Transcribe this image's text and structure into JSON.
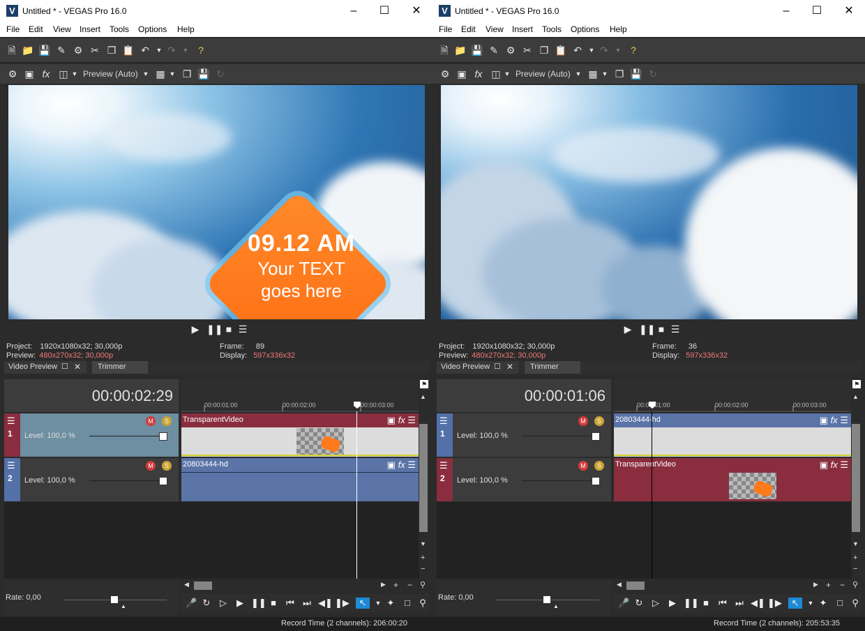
{
  "windows": [
    {
      "title": "Untitled * - VEGAS Pro 16.0",
      "menu": [
        "File",
        "Edit",
        "View",
        "Insert",
        "Tools",
        "Options",
        "Help"
      ],
      "preview_mode": "Preview (Auto)",
      "overlay": {
        "time": "09.12 AM",
        "line1": "Your TEXT",
        "line2": "goes here"
      },
      "info": {
        "project_label": "Project:",
        "project_value": "1920x1080x32; 30,000p",
        "preview_label": "Preview:",
        "preview_value": "480x270x32; 30,000p",
        "frame_label": "Frame:",
        "frame_value": "89",
        "display_label": "Display:",
        "display_value": "597x336x32"
      },
      "tabs": {
        "active": "Video Preview",
        "second": "Trimmer"
      },
      "timecode": "00:00:02:29",
      "ruler": [
        "00:00:01:00",
        "00:00:02:00",
        "00:00:03:00"
      ],
      "tracks": [
        {
          "number": "1",
          "level": "Level: 100,0 %",
          "event": "TransparentVideo"
        },
        {
          "number": "2",
          "level": "Level: 100,0 %",
          "event": "20803444-hd"
        }
      ],
      "rate": "Rate: 0,00",
      "status": "Record Time (2 channels): 206:00:20"
    },
    {
      "title": "Untitled * - VEGAS Pro 16.0",
      "menu": [
        "File",
        "Edit",
        "View",
        "Insert",
        "Tools",
        "Options",
        "Help"
      ],
      "preview_mode": "Preview (Auto)",
      "info": {
        "project_label": "Project:",
        "project_value": "1920x1080x32; 30,000p",
        "preview_label": "Preview:",
        "preview_value": "480x270x32; 30,000p",
        "frame_label": "Frame:",
        "frame_value": "36",
        "display_label": "Display:",
        "display_value": "597x336x32"
      },
      "tabs": {
        "active": "Video Preview",
        "second": "Trimmer"
      },
      "timecode": "00:00:01:06",
      "ruler": [
        "00:00:01:00",
        "00:00:02:00",
        "00:00:03:00"
      ],
      "tracks": [
        {
          "number": "1",
          "level": "Level: 100,0 %",
          "event": "20803444-hd"
        },
        {
          "number": "2",
          "level": "Level: 100,0 %",
          "event": "TransparentVideo"
        }
      ],
      "rate": "Rate: 0,00",
      "status": "Record Time (2 channels): 205:53:35"
    }
  ],
  "colors": {
    "track_red": "#8a2e3f",
    "track_blue": "#5370a8",
    "event_red": "#8a2e3f",
    "event_blue": "#5a74a8",
    "highlight": "#1e8ad6"
  },
  "icons": [
    "new-icon",
    "open-icon",
    "save-icon",
    "save-as-icon",
    "properties-icon",
    "cut-icon",
    "copy-icon",
    "paste-icon",
    "undo-icon",
    "redo-icon",
    "help-icon",
    "play-icon",
    "pause-icon",
    "stop-icon",
    "menu-icon",
    "fx-icon",
    "crop-icon",
    "mute-icon",
    "solo-icon"
  ]
}
